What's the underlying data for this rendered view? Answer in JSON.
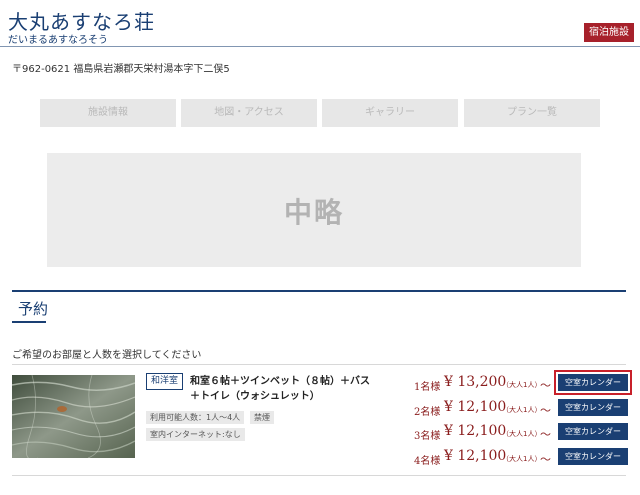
{
  "header": {
    "site_name": "大丸あすなろ荘",
    "site_name_kana": "だいまるあすなろそう",
    "facility_button": "宿泊施設"
  },
  "address": "〒962-0621 福島県岩瀬郡天栄村湯本字下二俣5",
  "nav": {
    "tabs": [
      {
        "label": "施設情報"
      },
      {
        "label": "地図・アクセス"
      },
      {
        "label": "ギャラリー"
      },
      {
        "label": "プラン一覧"
      }
    ]
  },
  "placeholder": {
    "label": "中略"
  },
  "reservation": {
    "title": "予約",
    "instruction": "ご希望のお部屋と人数を選択してください"
  },
  "room": {
    "type_badge": "和洋室",
    "name": "和室６帖＋ツインベット（８帖）＋バス＋トイレ（ウォシュレット）",
    "tags": [
      {
        "label": "利用可能人数：1人〜4人"
      },
      {
        "label": "禁煙"
      },
      {
        "label": "室内インターネット:なし"
      }
    ],
    "prices": [
      {
        "guests": "1名様",
        "price": "¥ 13,200",
        "per": "（大人1人）",
        "tilde": "〜",
        "button": "空室カレンダー"
      },
      {
        "guests": "2名様",
        "price": "¥ 12,100",
        "per": "（大人1人）",
        "tilde": "〜",
        "button": "空室カレンダー"
      },
      {
        "guests": "3名様",
        "price": "¥ 12,100",
        "per": "（大人1人）",
        "tilde": "〜",
        "button": "空室カレンダー"
      },
      {
        "guests": "4名様",
        "price": "¥ 12,100",
        "per": "（大人1人）",
        "tilde": "〜",
        "button": "空室カレンダー"
      }
    ]
  },
  "colors": {
    "brand_navy": "#1a3f73",
    "accent_red": "#a7212b",
    "price_red": "#8a1d1d",
    "highlight": "#c8202a"
  }
}
